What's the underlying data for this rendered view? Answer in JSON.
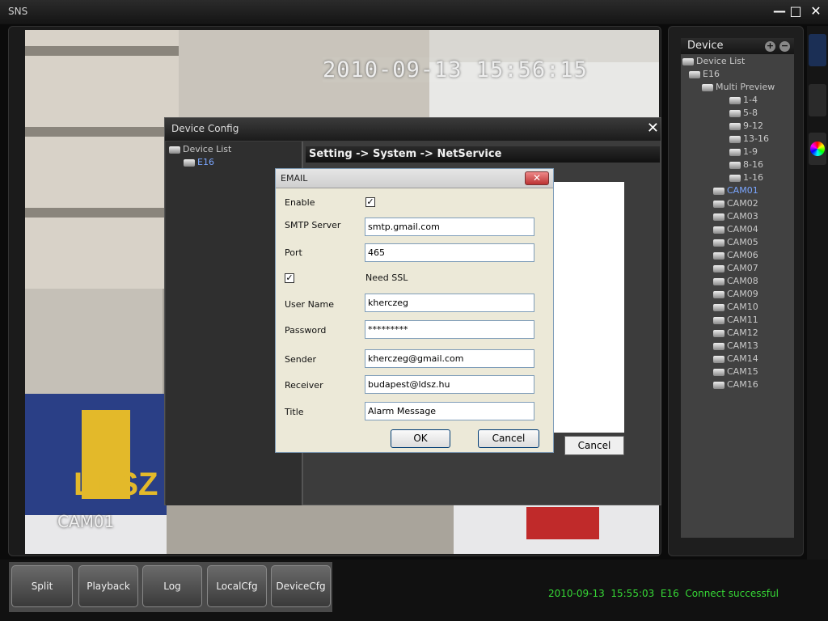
{
  "window": {
    "title": "SNS",
    "minimize": "—",
    "maximize": "□",
    "close": "✕"
  },
  "video": {
    "timestamp": "2010-09-13 15:56:15",
    "camera_label": "CAM01"
  },
  "device_config": {
    "title": "Device Config",
    "tree": {
      "root": "Device List",
      "device": "E16"
    },
    "breadcrumb": "Setting -> System -> NetService",
    "cancel": "Cancel"
  },
  "email_dialog": {
    "title": "EMAIL",
    "enable_label": "Enable",
    "enable_checked": "✓",
    "smtp_label": "SMTP Server",
    "smtp_value": "smtp.gmail.com",
    "port_label": "Port",
    "port_value": "465",
    "ssl_checked": "✓",
    "ssl_label": "Need SSL",
    "username_label": "User Name",
    "username_value": "kherczeg",
    "password_label": "Password",
    "password_value": "*********",
    "sender_label": "Sender",
    "sender_value": "kherczeg@gmail.com",
    "receiver_label": "Receiver",
    "receiver_value": "budapest@ldsz.hu",
    "title_label": "Title",
    "title_value": "Alarm Message",
    "ok": "OK",
    "cancel": "Cancel"
  },
  "device_panel": {
    "header": "Device",
    "tree": {
      "root": "Device List",
      "device": "E16",
      "multi_preview": "Multi Preview",
      "previews": [
        "1-4",
        "5-8",
        "9-12",
        "13-16",
        "1-9",
        "8-16",
        "1-16"
      ],
      "cameras": [
        "CAM01",
        "CAM02",
        "CAM03",
        "CAM04",
        "CAM05",
        "CAM06",
        "CAM07",
        "CAM08",
        "CAM09",
        "CAM10",
        "CAM11",
        "CAM12",
        "CAM13",
        "CAM14",
        "CAM15",
        "CAM16"
      ]
    }
  },
  "toolbar": {
    "buttons": [
      "Split",
      "Playback",
      "Log",
      "LocalCfg",
      "DeviceCfg"
    ]
  },
  "status_bar": {
    "text": "2010-09-13  15:55:03  E16  Connect successful"
  },
  "colors": {
    "status_text": "#36d936",
    "selected_item": "#7aa6ff",
    "background": "#0b0b0b"
  }
}
